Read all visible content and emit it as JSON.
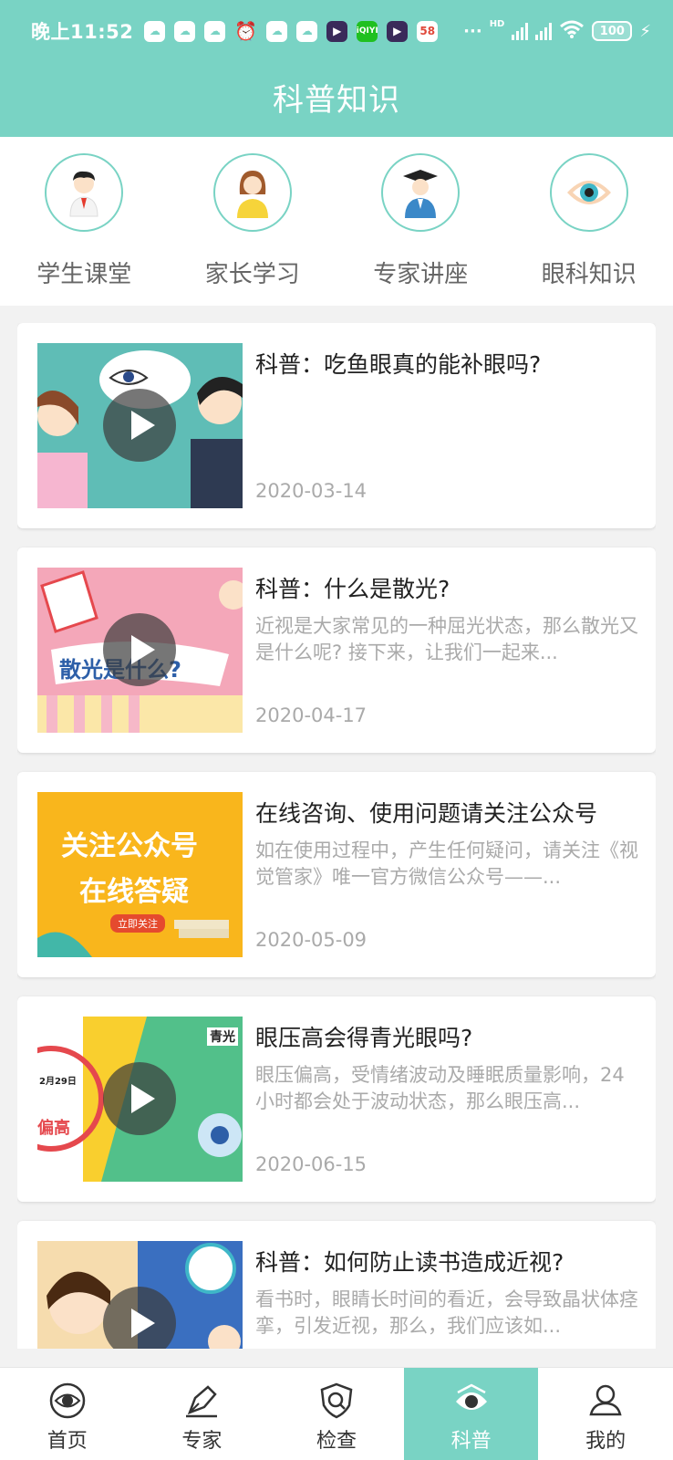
{
  "status_bar": {
    "time": "晚上11:52",
    "net_label": "HD",
    "battery": "100",
    "app_icons": [
      "cloud-icon",
      "cloud-icon",
      "cloud-icon",
      "alarm-icon",
      "cloud-icon",
      "cloud-icon",
      "video-app-icon",
      "iqiyi-icon",
      "video-app-icon",
      "58-app-icon"
    ],
    "iqiyi_label": "iQIYI",
    "app58_label": "58",
    "more": "···"
  },
  "header": {
    "title": "科普知识"
  },
  "categories": [
    {
      "label": "学生课堂",
      "icon": "student-icon"
    },
    {
      "label": "家长学习",
      "icon": "parent-icon"
    },
    {
      "label": "专家讲座",
      "icon": "expert-icon"
    },
    {
      "label": "眼科知识",
      "icon": "eye-icon"
    }
  ],
  "articles": [
    {
      "title": "科普：吃鱼眼真的能补眼吗?",
      "desc": "",
      "date": "2020-03-14",
      "has_video": true
    },
    {
      "title": "科普：什么是散光?",
      "desc": "近视是大家常见的一种屈光状态，那么散光又是什么呢? 接下来，让我们一起来...",
      "date": "2020-04-17",
      "has_video": true,
      "thumb_text": "散光是什么?"
    },
    {
      "title": "在线咨询、使用问题请关注公众号",
      "desc": "如在使用过程中，产生任何疑问，请关注《视觉管家》唯一官方微信公众号——...",
      "date": "2020-05-09",
      "has_video": false,
      "thumb_text_1": "关注公众号",
      "thumb_text_2": "在线答疑",
      "thumb_button": "立即关注"
    },
    {
      "title": "眼压高会得青光眼吗?",
      "desc": "眼压偏高，受情绪波动及睡眠质量影响，24小时都会处于波动状态，那么眼压高...",
      "date": "2020-06-15",
      "has_video": true,
      "thumb_text_1": "青光",
      "thumb_text_2": "2月29日",
      "thumb_text_3": "偏高"
    },
    {
      "title": "科普：如何防止读书造成近视?",
      "desc": "看书时，眼睛长时间的看近，会导致晶状体痉挛，引发近视，那么，我们应该如...",
      "date": "",
      "has_video": true
    }
  ],
  "nav": [
    {
      "label": "首页",
      "icon": "home-eye-icon",
      "active": false
    },
    {
      "label": "专家",
      "icon": "pen-icon",
      "active": false
    },
    {
      "label": "检查",
      "icon": "shield-check-icon",
      "active": false
    },
    {
      "label": "科普",
      "icon": "science-eye-icon",
      "active": true
    },
    {
      "label": "我的",
      "icon": "user-icon",
      "active": false
    }
  ],
  "colors": {
    "accent": "#79d3c4",
    "title_text": "#222222",
    "muted_text": "#aaaaaa"
  }
}
